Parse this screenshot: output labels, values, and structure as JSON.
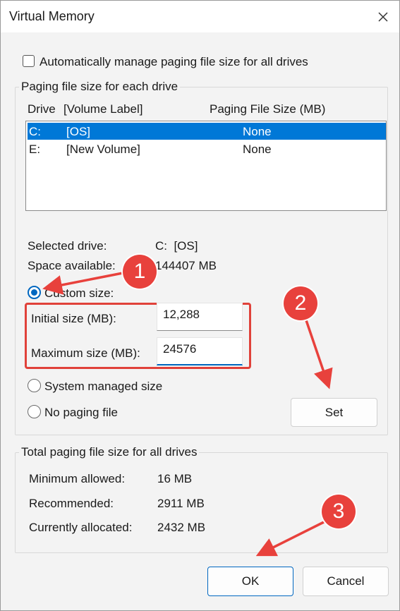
{
  "window": {
    "title": "Virtual Memory"
  },
  "auto_manage": {
    "label": "Automatically manage paging file size for all drives",
    "checked": false
  },
  "per_drive_group": {
    "label": "Paging file size for each drive",
    "columns": {
      "drive": "Drive",
      "volume_label": "[Volume Label]",
      "paging_size": "Paging File Size (MB)"
    },
    "rows": [
      {
        "drive": "C:",
        "label": "[OS]",
        "size": "None",
        "selected": true
      },
      {
        "drive": "E:",
        "label": "[New Volume]",
        "size": "None",
        "selected": false
      }
    ],
    "selected_drive_label": "Selected drive:",
    "selected_drive_value": "C:  [OS]",
    "space_available_label": "Space available:",
    "space_available_value": "144407 MB",
    "custom_size_label": "Custom size:",
    "initial_size_label": "Initial size (MB):",
    "initial_size_value": "12,288",
    "maximum_size_label": "Maximum size (MB):",
    "maximum_size_value": "24576",
    "system_managed_label": "System managed size",
    "no_paging_label": "No paging file",
    "set_button": "Set",
    "selected_option": "custom"
  },
  "totals_group": {
    "label": "Total paging file size for all drives",
    "minimum_label": "Minimum allowed:",
    "minimum_value": "16 MB",
    "recommended_label": "Recommended:",
    "recommended_value": "2911 MB",
    "allocated_label": "Currently allocated:",
    "allocated_value": "2432 MB"
  },
  "buttons": {
    "ok": "OK",
    "cancel": "Cancel"
  },
  "annotations": {
    "step1": "1",
    "step2": "2",
    "step3": "3",
    "color": "#e8413c"
  },
  "colors": {
    "selection": "#0078d7",
    "accent": "#0067c0"
  }
}
